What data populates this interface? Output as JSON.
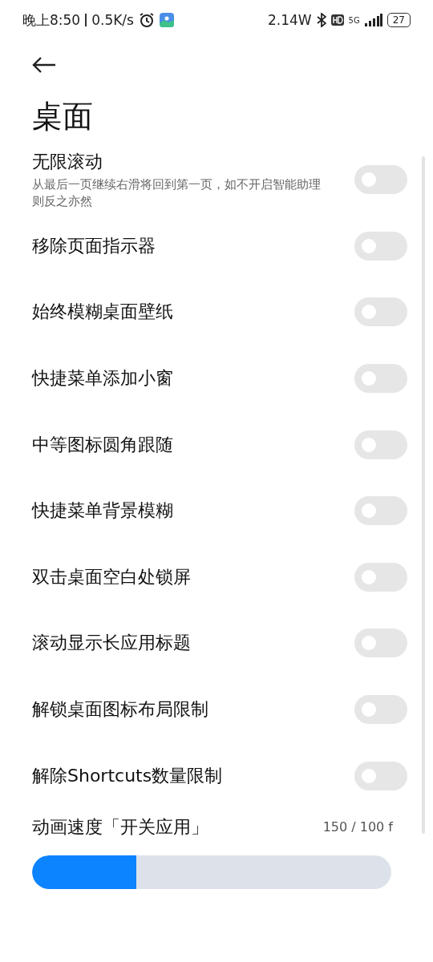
{
  "status_bar": {
    "time": "晚上8:50",
    "speed": "0.5K/s",
    "power": "2.14W",
    "network": "5G",
    "battery": "27"
  },
  "title": "桌面",
  "settings": [
    {
      "label": "无限滚动",
      "description": "从最后一页继续右滑将回到第一页，如不开启智能助理则反之亦然",
      "on": false
    },
    {
      "label": "移除页面指示器",
      "on": false
    },
    {
      "label": "始终模糊桌面壁纸",
      "on": false
    },
    {
      "label": "快捷菜单添加小窗",
      "on": false
    },
    {
      "label": "中等图标圆角跟随",
      "on": false
    },
    {
      "label": "快捷菜单背景模糊",
      "on": false
    },
    {
      "label": "双击桌面空白处锁屏",
      "on": false
    },
    {
      "label": "滚动显示长应用标题",
      "on": false
    },
    {
      "label": "解锁桌面图标布局限制",
      "on": false
    },
    {
      "label": "解除Shortcuts数量限制",
      "on": false
    }
  ],
  "slider": {
    "label": "动画速度「开关应用」",
    "reading": "150 / 100 f",
    "level": 0.29
  }
}
